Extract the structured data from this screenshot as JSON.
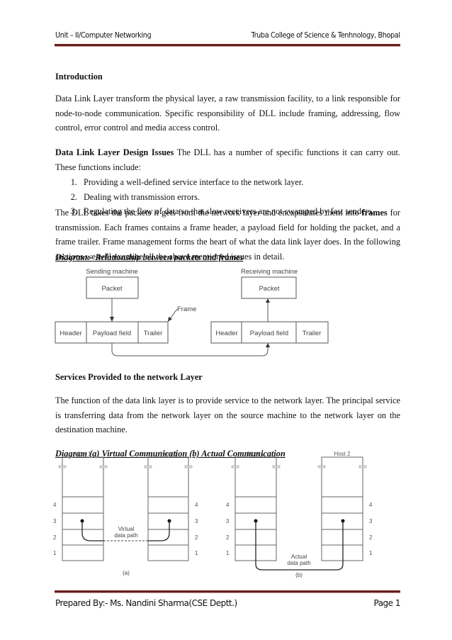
{
  "header": {
    "left": "Unit – II/Computer Networking",
    "right": "Truba College of Science & Tenhnology, Bhopal"
  },
  "sections": {
    "intro_heading": "Introduction",
    "intro_text": "Data Link Layer  transform the physical layer, a raw transmission facility, to a link responsible for node-to-node communication. Specific responsibility of DLL include framing, addressing, flow control, error control and media access control.",
    "design_heading": "Data Link Layer Design Issues",
    "design_text": " The DLL has a number of specific functions it can carry out. These functions include:",
    "design_list": [
      "Providing a well-defined service interface to the network layer.",
      "Dealing with transmission errors.",
      "Regulating the flow of data so that slow receivers are not swamped by fast senders."
    ],
    "frames_text_before": "The DLL takes the packets it gets from the network layer and encapsulates them into ",
    "frames_bold": "frames",
    "frames_text_after": " for transmission.  Each frames contains a frame header, a payload field for holding the packet, and a frame trailer. Frame management forms the heart  of what the data link layer does. In the following sections we will examine all the above mentioned issues in detail.",
    "diagram1_caption": "Diagram:- Relationship between packets and frames",
    "services_heading": "Services Provided to the network Layer",
    "services_text": "The function of the data link layer is to provide service to the network layer. The principal service is transferring data from the network layer on the source machine to the network layer on the destination machine.",
    "diagram2_caption": "Diagram (a) Virtual Communication (b)  Actual Communication"
  },
  "diagram1": {
    "sending_label": "Sending machine",
    "receiving_label": "Receiving machine",
    "packet_label": "Packet",
    "frame_label": "Frame",
    "fields": [
      "Header",
      "Payload field",
      "Trailer"
    ]
  },
  "diagram2": {
    "host1": "Host 1",
    "host2": "Host 2",
    "layers": [
      "4",
      "3",
      "2",
      "1"
    ],
    "virtual_line1": "Virtual",
    "virtual_line2": "data path",
    "actual_line1": "Actual",
    "actual_line2": "data path",
    "label_a": "(a)",
    "label_b": "(b)"
  },
  "footer": {
    "left": "Prepared By:- Ms. Nandini Sharma(CSE Deptt.)",
    "right": "Page 1"
  }
}
